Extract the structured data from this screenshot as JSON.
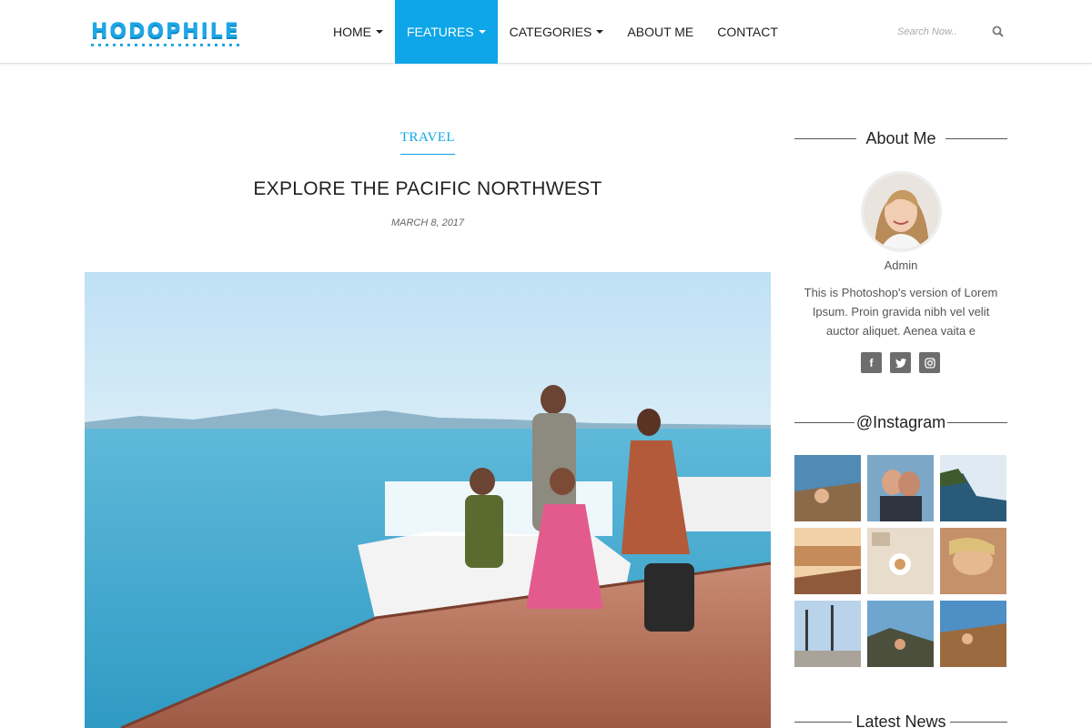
{
  "brand": {
    "logo_text": "HODOPHILE"
  },
  "nav": {
    "items": [
      {
        "label": "HOME",
        "dropdown": true,
        "active": false
      },
      {
        "label": "FEATURES",
        "dropdown": true,
        "active": true
      },
      {
        "label": "CATEGORIES",
        "dropdown": true,
        "active": false
      },
      {
        "label": "ABOUT ME",
        "dropdown": false,
        "active": false
      },
      {
        "label": "CONTACT",
        "dropdown": false,
        "active": false
      }
    ],
    "search_placeholder": "Search Now..",
    "search_icon": "magnifier"
  },
  "post": {
    "category": "TRAVEL",
    "title": "EXPLORE THE PACIFIC NORTHWEST",
    "date": "MARCH 8, 2017",
    "image": "family running on a wooden pier by the sea with a boat"
  },
  "sidebar": {
    "about": {
      "title": "About Me",
      "name": "Admin",
      "text": "This is Photoshop's version of Lorem Ipsum. Proin gravida nibh vel velit auctor aliquet. Aenea vaita e",
      "socials": [
        {
          "icon": "facebook-icon",
          "glyph": "f"
        },
        {
          "icon": "twitter-icon",
          "glyph": "t"
        },
        {
          "icon": "instagram-icon",
          "glyph": "◎"
        }
      ]
    },
    "instagram": {
      "title": "@Instagram",
      "photo_count": 9
    },
    "latest_news": {
      "title": "Latest News"
    }
  },
  "colors": {
    "accent": "#0ea6e8",
    "text": "#222222",
    "muted": "#666666",
    "social_bg": "#6d6d6d"
  }
}
